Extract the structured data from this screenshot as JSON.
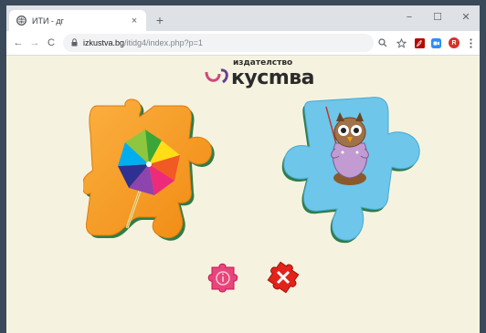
{
  "browser": {
    "tab_title": "ИТИ - дг",
    "tab_close": "×",
    "new_tab": "+",
    "window_minimize": "−",
    "window_maximize": "☐",
    "window_close": "✕",
    "back": "←",
    "forward": "→",
    "reload": "C",
    "url_host": "izkustva.bg",
    "url_path": "/itidg4/index.php?p=1",
    "profile_initial": "R"
  },
  "logo": {
    "small_text": "издателство",
    "big_text": "кусmва"
  },
  "colors": {
    "page_bg": "#f5f3df",
    "puzzle_left": "#f7941d",
    "puzzle_right": "#6ec6ea",
    "info_button": "#e8457a",
    "close_button": "#e2231a"
  },
  "icons": {
    "left_puzzle_picture": "pinwheel-icon",
    "right_puzzle_picture": "owl-teacher-icon",
    "info_button": "info-puzzle-icon",
    "close_button": "close-puzzle-icon"
  }
}
